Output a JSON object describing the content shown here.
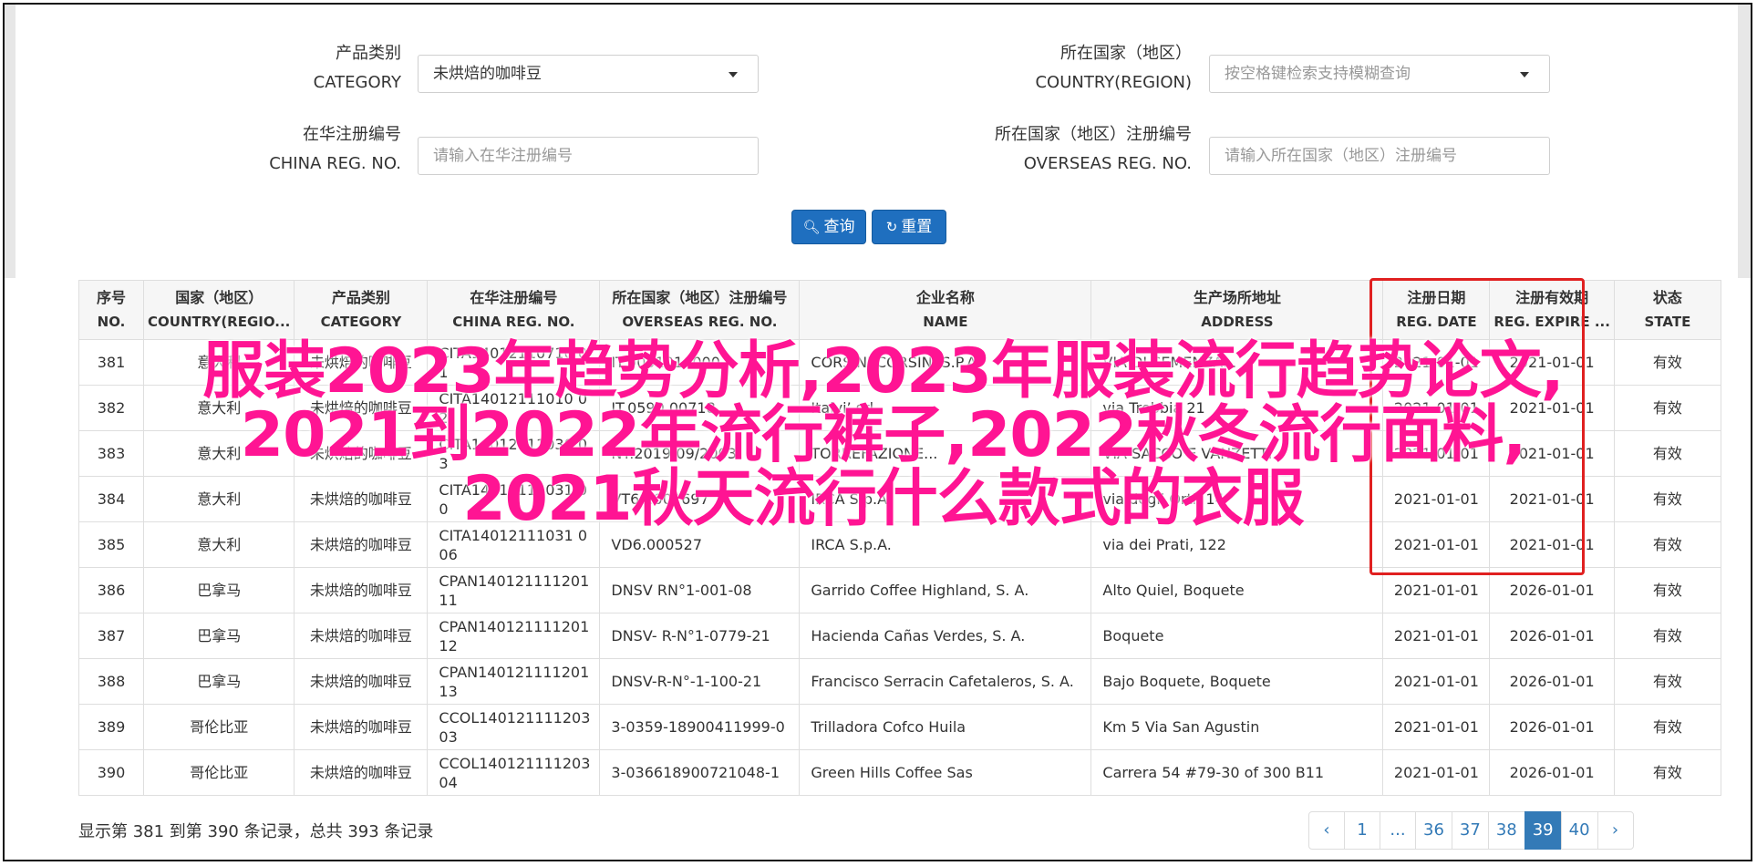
{
  "filters": {
    "category": {
      "label_cn": "产品类别",
      "label_en": "CATEGORY",
      "value": "未烘焙的咖啡豆"
    },
    "country": {
      "label_cn": "所在国家（地区）",
      "label_en": "COUNTRY(REGION)",
      "placeholder": "按空格键检索支持模糊查询"
    },
    "china_reg": {
      "label_cn": "在华注册编号",
      "label_en": "CHINA REG. NO.",
      "placeholder": "请输入在华注册编号"
    },
    "overseas_reg": {
      "label_cn": "所在国家（地区）注册编号",
      "label_en": "OVERSEAS REG. NO.",
      "placeholder": "请输入所在国家（地区）注册编号"
    },
    "search_label": "查询",
    "reset_label": "重置"
  },
  "table": {
    "headers": [
      {
        "cn": "序号",
        "en": "NO."
      },
      {
        "cn": "国家（地区）",
        "en": "COUNTRY(REGIO..."
      },
      {
        "cn": "产品类别",
        "en": "CATEGORY"
      },
      {
        "cn": "在华注册编号",
        "en": "CHINA REG. NO."
      },
      {
        "cn": "所在国家（地区）注册编号",
        "en": "OVERSEAS REG. NO."
      },
      {
        "cn": "企业名称",
        "en": "NAME"
      },
      {
        "cn": "生产场所地址",
        "en": "ADDRESS"
      },
      {
        "cn": "注册日期",
        "en": "REG. DATE"
      },
      {
        "cn": "注册有效期",
        "en": "REG. EXPIRE ..."
      },
      {
        "cn": "状态",
        "en": "STATE"
      }
    ],
    "rows": [
      {
        "no": "381",
        "country": "意大利",
        "category": "未烘焙的咖啡豆",
        "china_reg": "CITA14012110710 01",
        "overseas_reg": "IT.9051016000...",
        "name": "CORSINI CORSINI S.P.A.",
        "address": "VIA DI SEMENZA...",
        "reg_date": "2021-01-01",
        "expire": "2021-01-01",
        "state": "有效"
      },
      {
        "no": "382",
        "country": "意大利",
        "category": "未烘焙的咖啡豆",
        "china_reg": "CITA14012111010 02",
        "overseas_reg": "IT.0590.00718",
        "name": "Italvi’ srl",
        "address": "via Trebbia 21",
        "reg_date": "2021-01-01",
        "expire": "2021-01-01",
        "state": "有效"
      },
      {
        "no": "383",
        "country": "意大利",
        "category": "未烘焙的咖啡豆",
        "china_reg": "CITA14012111030 03",
        "overseas_reg": "NT.2019/09/2003",
        "name": "TORREFAZIONE...",
        "address": "VIA SACCO E VANZETTI",
        "reg_date": "2021-01-01",
        "expire": "2021-01-01",
        "state": "有效"
      },
      {
        "no": "384",
        "country": "意大利",
        "category": "未烘焙的咖啡豆",
        "china_reg": "CITA14012111031 00",
        "overseas_reg": "VT69.002697",
        "name": "IRCA S.p.A.",
        "address": "via degli Orti, 14",
        "reg_date": "2021-01-01",
        "expire": "2021-01-01",
        "state": "有效"
      },
      {
        "no": "385",
        "country": "意大利",
        "category": "未烘焙的咖啡豆",
        "china_reg": "CITA14012111031 006",
        "overseas_reg": "VD6.000527",
        "name": "IRCA S.p.A.",
        "address": "via dei Prati, 122",
        "reg_date": "2021-01-01",
        "expire": "2021-01-01",
        "state": "有效"
      },
      {
        "no": "386",
        "country": "巴拿马",
        "category": "未烘焙的咖啡豆",
        "china_reg": "CPAN14012111120111",
        "overseas_reg": "DNSV RN°1-001-08",
        "name": "Garrido Coffee Highland, S. A.",
        "address": "Alto Quiel, Boquete",
        "reg_date": "2021-01-01",
        "expire": "2026-01-01",
        "state": "有效"
      },
      {
        "no": "387",
        "country": "巴拿马",
        "category": "未烘焙的咖啡豆",
        "china_reg": "CPAN14012111120112",
        "overseas_reg": "DNSV- R-N°1-0779-21",
        "name": "Hacienda Cañas Verdes, S. A.",
        "address": "Boquete",
        "reg_date": "2021-01-01",
        "expire": "2026-01-01",
        "state": "有效"
      },
      {
        "no": "388",
        "country": "巴拿马",
        "category": "未烘焙的咖啡豆",
        "china_reg": "CPAN14012111120113",
        "overseas_reg": "DNSV-R-N°-1-100-21",
        "name": "Francisco Serracin Cafetaleros, S. A.",
        "address": "Bajo Boquete, Boquete",
        "reg_date": "2021-01-01",
        "expire": "2026-01-01",
        "state": "有效"
      },
      {
        "no": "389",
        "country": "哥伦比亚",
        "category": "未烘焙的咖啡豆",
        "china_reg": "CCOL14012111120303",
        "overseas_reg": "3-0359-18900411999-0",
        "name": "Trilladora Cofco Huila",
        "address": "Km 5 Via San Agustin",
        "reg_date": "2021-01-01",
        "expire": "2026-01-01",
        "state": "有效"
      },
      {
        "no": "390",
        "country": "哥伦比亚",
        "category": "未烘焙的咖啡豆",
        "china_reg": "CCOL14012111120304",
        "overseas_reg": "3-036618900721048-1",
        "name": "Green Hills Coffee Sas",
        "address": "Carrera 54 #79-30 of 300 B11",
        "reg_date": "2021-01-01",
        "expire": "2026-01-01",
        "state": "有效"
      }
    ]
  },
  "footer": {
    "summary": "显示第 381 到第 390 条记录，总共 393 条记录",
    "pages": [
      "‹",
      "1",
      "...",
      "36",
      "37",
      "38",
      "39",
      "40",
      "›"
    ],
    "active_page": "39"
  },
  "overlay": {
    "line1": "服装2023年趋势分析,2023年服装流行趋势论文,",
    "line2": "2021到2022年流行裤子,2022秋冬流行面料,",
    "line3": "2021秋天流行什么款式的衣服"
  },
  "colors": {
    "primary": "#1f6fbf",
    "highlight_box": "#e02020",
    "overlay_text": "#ff1493"
  }
}
